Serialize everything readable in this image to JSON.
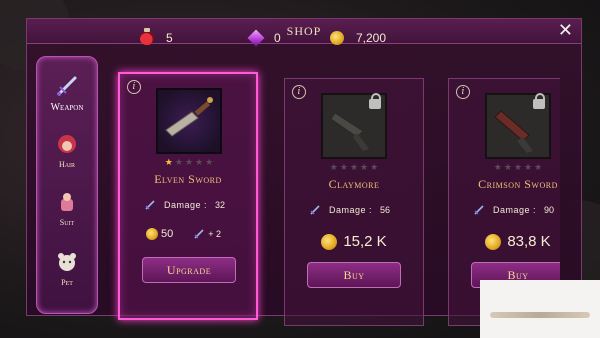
{
  "shop": {
    "title": "SHOP",
    "close_glyph": "✕"
  },
  "currencies": [
    {
      "icon": "potion-icon",
      "value": "5"
    },
    {
      "icon": "gem-icon",
      "value": "0"
    },
    {
      "icon": "coin-icon",
      "value": "7,200"
    }
  ],
  "sidebar": {
    "items": [
      {
        "label": "Weapon",
        "active": true
      },
      {
        "label": "Hair",
        "active": false
      },
      {
        "label": "Suit",
        "active": false
      },
      {
        "label": "Pet",
        "active": false
      }
    ]
  },
  "cards": [
    {
      "name": "Elven Sword",
      "rating": 1,
      "max_rating": 5,
      "damage_label": "Damage :",
      "damage": "32",
      "price": "50",
      "bonus": "+ 2",
      "button": "Upgrade",
      "locked": false,
      "selected": true
    },
    {
      "name": "Claymore",
      "rating": 0,
      "max_rating": 5,
      "damage_label": "Damage :",
      "damage": "56",
      "price": "15,2 K",
      "button": "Buy",
      "locked": true,
      "selected": false
    },
    {
      "name": "Crimson Sword",
      "rating": 0,
      "max_rating": 5,
      "damage_label": "Damage :",
      "damage": "90",
      "price": "83,8 K",
      "button": "Buy",
      "locked": true,
      "selected": false
    }
  ],
  "colors": {
    "accent": "#ff5ad9",
    "gold_text": "#f0c27a",
    "panel": "#34102c"
  }
}
